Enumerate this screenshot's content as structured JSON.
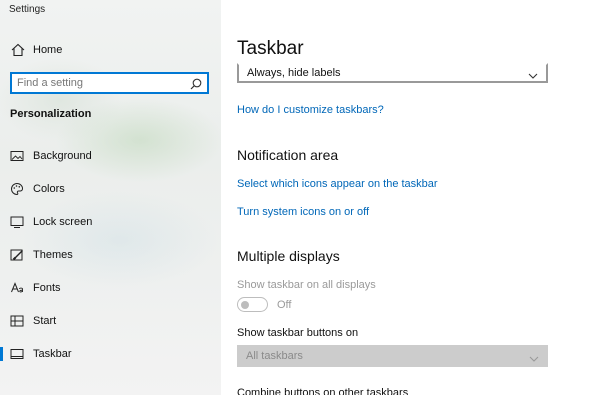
{
  "app": {
    "title": "Settings"
  },
  "sidebar": {
    "home_label": "Home",
    "search_placeholder": "Find a setting",
    "section_title": "Personalization",
    "items": [
      {
        "label": "Background",
        "icon": "picture-icon"
      },
      {
        "label": "Colors",
        "icon": "palette-icon"
      },
      {
        "label": "Lock screen",
        "icon": "lock-screen-icon"
      },
      {
        "label": "Themes",
        "icon": "brush-icon"
      },
      {
        "label": "Fonts",
        "icon": "font-icon"
      },
      {
        "label": "Start",
        "icon": "start-icon"
      },
      {
        "label": "Taskbar",
        "icon": "taskbar-icon",
        "selected": true
      }
    ]
  },
  "main": {
    "title": "Taskbar",
    "labels_dropdown": {
      "value": "Always, hide labels"
    },
    "customize_link": "How do I customize taskbars?",
    "notification_area": {
      "heading": "Notification area",
      "links": [
        "Select which icons appear on the taskbar",
        "Turn system icons on or off"
      ]
    },
    "multiple_displays": {
      "heading": "Multiple displays",
      "show_on_all_label": "Show taskbar on all displays",
      "toggle_state": "Off",
      "buttons_on_label": "Show taskbar buttons on",
      "buttons_on_value": "All taskbars",
      "combine_label": "Combine buttons on other taskbars"
    }
  },
  "colors": {
    "accent": "#0078d4",
    "link": "#0067b8",
    "disabled": "#9a9a9a"
  }
}
